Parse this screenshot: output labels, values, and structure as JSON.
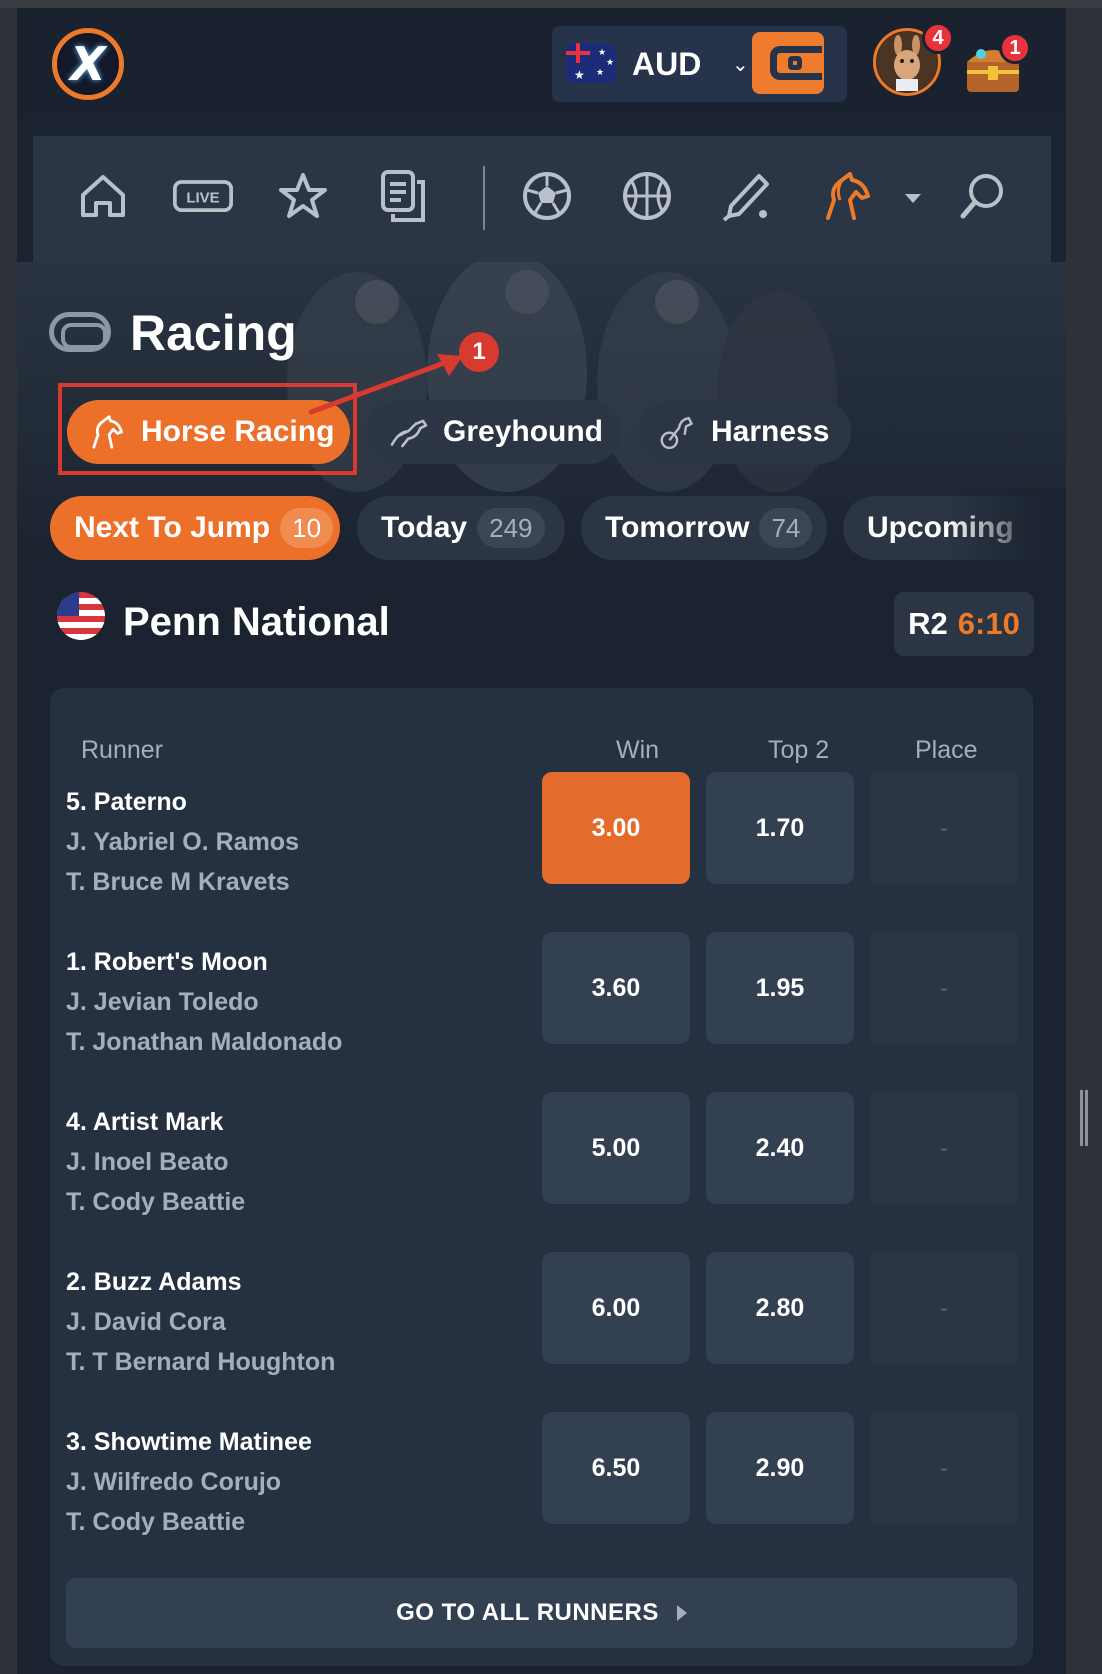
{
  "header": {
    "logo_text": "X",
    "currency": "AUD",
    "avatar_badge": "4",
    "rewards_badge": "1"
  },
  "nav": {
    "icons": [
      "home-icon",
      "live-icon",
      "star-icon",
      "betslip-icon",
      "soccer-icon",
      "basketball-icon",
      "cricket-icon",
      "horse-icon",
      "search-icon"
    ],
    "live_label": "LIVE"
  },
  "page": {
    "title": "Racing"
  },
  "race_types": [
    {
      "label": "Horse Racing",
      "active": true
    },
    {
      "label": "Greyhound",
      "active": false
    },
    {
      "label": "Harness",
      "active": false
    }
  ],
  "day_filters": [
    {
      "label": "Next To Jump",
      "count": "10",
      "active": true
    },
    {
      "label": "Today",
      "count": "249",
      "active": false
    },
    {
      "label": "Tomorrow",
      "count": "74",
      "active": false
    },
    {
      "label": "Upcoming",
      "count": "",
      "active": false
    }
  ],
  "annotation": {
    "number": "1"
  },
  "event": {
    "name": "Penn National",
    "race_number": "R2",
    "race_time": "6:10"
  },
  "table": {
    "columns": [
      "Runner",
      "Win",
      "Top 2",
      "Place"
    ],
    "runners": [
      {
        "name": "5. Paterno",
        "jockey": "J. Yabriel O. Ramos",
        "trainer": "T. Bruce M Kravets",
        "win": "3.00",
        "top2": "1.70",
        "place": "-",
        "win_selected": true
      },
      {
        "name": "1. Robert's Moon",
        "jockey": "J. Jevian Toledo",
        "trainer": "T. Jonathan Maldonado",
        "win": "3.60",
        "top2": "1.95",
        "place": "-",
        "win_selected": false
      },
      {
        "name": "4. Artist Mark",
        "jockey": "J. Inoel Beato",
        "trainer": "T. Cody Beattie",
        "win": "5.00",
        "top2": "2.40",
        "place": "-",
        "win_selected": false
      },
      {
        "name": "2. Buzz Adams",
        "jockey": "J. David Cora",
        "trainer": "T. T Bernard Houghton",
        "win": "6.00",
        "top2": "2.80",
        "place": "-",
        "win_selected": false
      },
      {
        "name": "3. Showtime Matinee",
        "jockey": "J. Wilfredo Corujo",
        "trainer": "T. Cody Beattie",
        "win": "6.50",
        "top2": "2.90",
        "place": "-",
        "win_selected": false
      }
    ],
    "all_runners_label": "GO TO ALL RUNNERS"
  },
  "colors": {
    "accent": "#ec6f2a",
    "background": "#1b2330",
    "panel": "#253140",
    "annotation": "#d73a2f"
  }
}
